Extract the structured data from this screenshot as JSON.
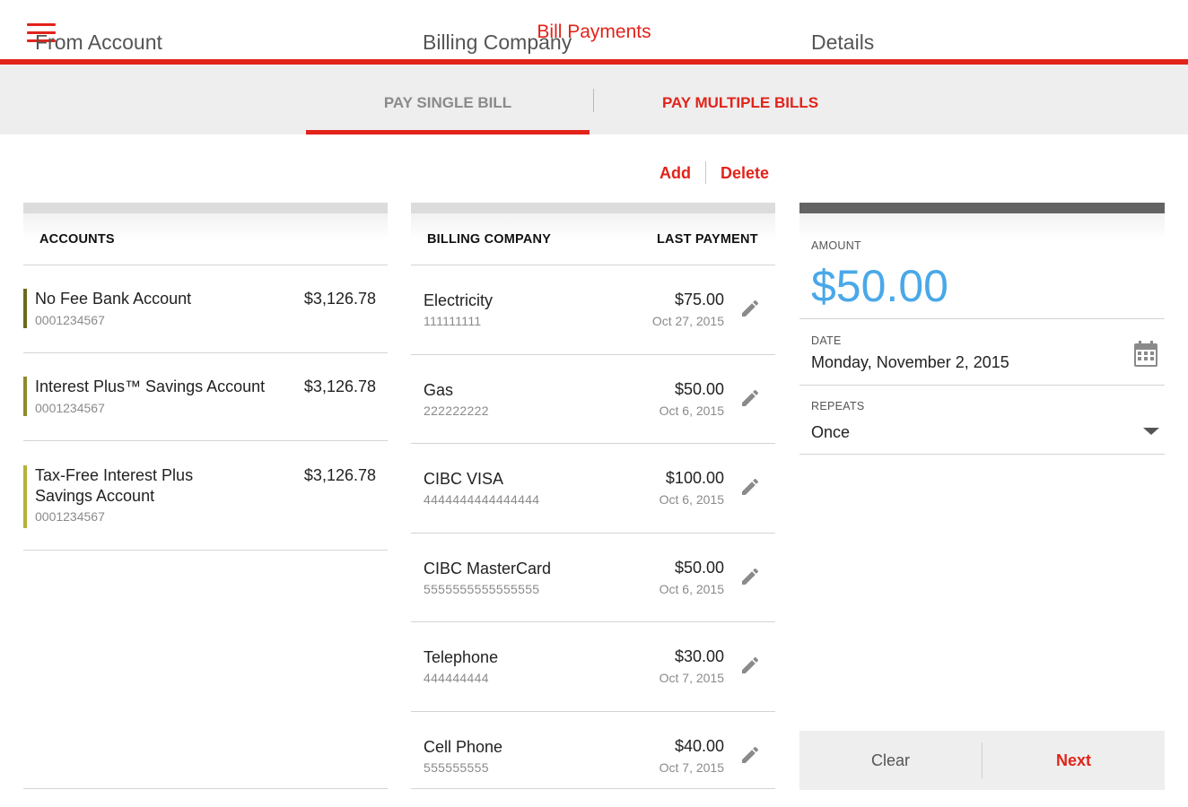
{
  "header": {
    "title": "Bill Payments"
  },
  "tabs": [
    {
      "label": "PAY SINGLE BILL",
      "active": true
    },
    {
      "label": "PAY MULTIPLE BILLS",
      "active": false
    }
  ],
  "from_account": {
    "title": "From Account",
    "column_header": "ACCOUNTS",
    "items": [
      {
        "name": "No Fee Bank Account",
        "number": "0001234567",
        "balance": "$3,126.78",
        "color": "#6b6a1c"
      },
      {
        "name": "Interest Plus™ Savings Account",
        "number": "0001234567",
        "balance": "$3,126.78",
        "color": "#8f8b2a"
      },
      {
        "name": "Tax-Free Interest Plus Savings Account",
        "number": "0001234567",
        "balance": "$3,126.78",
        "color": "#b5b23a"
      }
    ]
  },
  "billing": {
    "title": "Billing Company",
    "add_label": "Add",
    "delete_label": "Delete",
    "header_company": "BILLING COMPANY",
    "header_last": "LAST PAYMENT",
    "items": [
      {
        "name": "Electricity",
        "number": "111111111",
        "amount": "$75.00",
        "date": "Oct 27, 2015"
      },
      {
        "name": "Gas",
        "number": "222222222",
        "amount": "$50.00",
        "date": "Oct 6, 2015"
      },
      {
        "name": "CIBC VISA",
        "number": "4444444444444444",
        "amount": "$100.00",
        "date": "Oct 6, 2015"
      },
      {
        "name": "CIBC MasterCard",
        "number": "5555555555555555",
        "amount": "$50.00",
        "date": "Oct 6, 2015"
      },
      {
        "name": "Telephone",
        "number": "444444444",
        "amount": "$30.00",
        "date": "Oct 7, 2015"
      },
      {
        "name": "Cell Phone",
        "number": "555555555",
        "amount": "$40.00",
        "date": "Oct 7, 2015"
      }
    ]
  },
  "details": {
    "title": "Details",
    "amount_label": "AMOUNT",
    "amount": "$50.00",
    "date_label": "DATE",
    "date": "Monday, November 2, 2015",
    "repeats_label": "REPEATS",
    "repeats": "Once",
    "clear_label": "Clear",
    "next_label": "Next"
  },
  "colors": {
    "accent": "#e2231a",
    "amount": "#4aa8e8"
  }
}
